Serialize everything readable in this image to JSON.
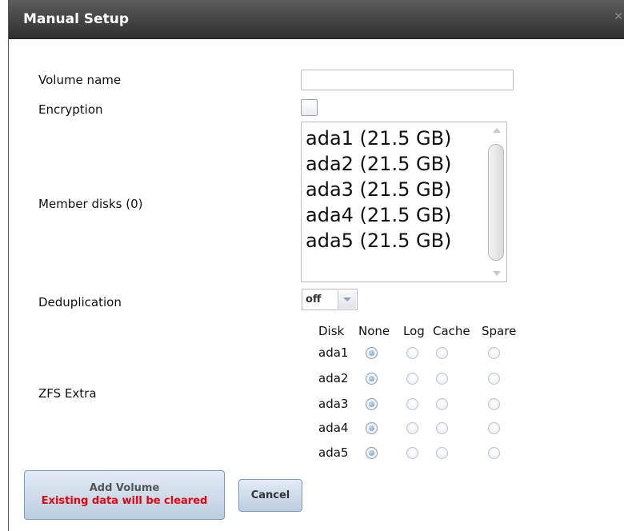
{
  "dialog": {
    "title": "Manual Setup",
    "close_glyph": "✕"
  },
  "form": {
    "volume_name_label": "Volume name",
    "volume_name_value": "",
    "encryption_label": "Encryption",
    "encryption_checked": false,
    "member_disks_label": "Member disks (0)",
    "member_disks_options": [
      "ada1 (21.5 GB)",
      "ada2 (21.5 GB)",
      "ada3 (21.5 GB)",
      "ada4 (21.5 GB)",
      "ada5 (21.5 GB)"
    ],
    "dedup_label": "Deduplication",
    "dedup_value": "off",
    "zfs_extra_label": "ZFS Extra"
  },
  "zfs_extra": {
    "headers": [
      "Disk",
      "None",
      "Log",
      "Cache",
      "Spare"
    ],
    "rows": [
      {
        "disk": "ada1",
        "selected": "None"
      },
      {
        "disk": "ada2",
        "selected": "None"
      },
      {
        "disk": "ada3",
        "selected": "None"
      },
      {
        "disk": "ada4",
        "selected": "None"
      },
      {
        "disk": "ada5",
        "selected": "None"
      }
    ]
  },
  "buttons": {
    "add_volume": "Add Volume",
    "add_volume_warning": "Existing data will be cleared",
    "cancel": "Cancel"
  },
  "colors": {
    "titlebar": "#3f3f3f",
    "warning_text": "#e8000c",
    "button_bg": "#cbd9e9"
  }
}
